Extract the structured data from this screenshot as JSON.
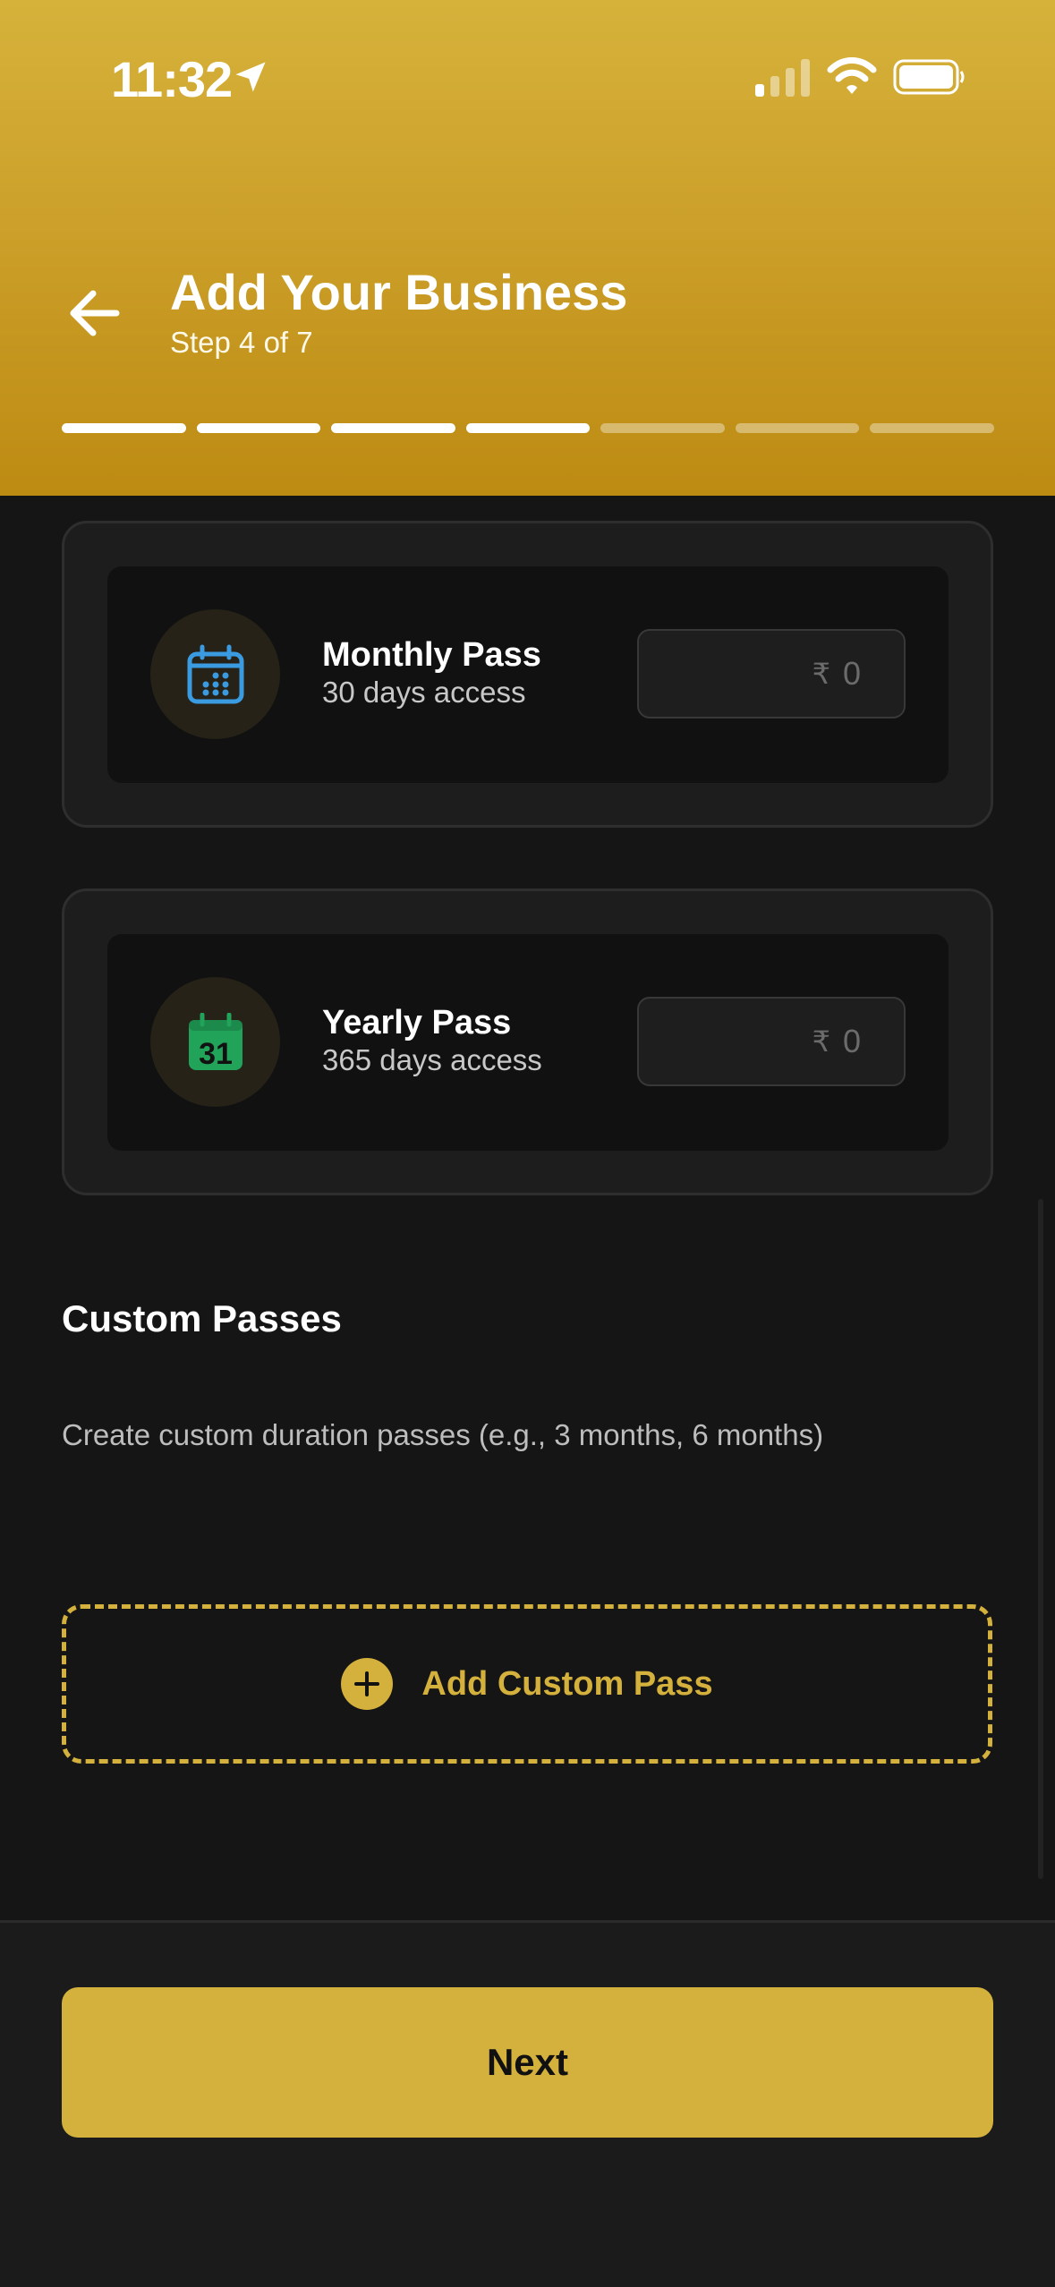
{
  "status_bar": {
    "time": "11:32"
  },
  "header": {
    "title": "Add Your Business",
    "subtitle": "Step 4 of 7",
    "progress": {
      "current_step": 4,
      "total_steps": 7
    }
  },
  "passes": [
    {
      "name": "Monthly Pass",
      "description": "30 days access",
      "currency": "₹",
      "placeholder": "0",
      "icon": "calendar-icon",
      "icon_color": "#3b9be0"
    },
    {
      "name": "Yearly Pass",
      "description": "365 days access",
      "currency": "₹",
      "placeholder": "0",
      "icon": "calendar-31-icon",
      "icon_color": "#22a35a",
      "icon_text": "31"
    }
  ],
  "custom": {
    "title": "Custom Passes",
    "description": "Create custom duration passes (e.g., 3 months, 6 months)",
    "add_label": "Add Custom Pass"
  },
  "footer": {
    "next_label": "Next"
  },
  "colors": {
    "accent": "#d4b03c",
    "background": "#151515",
    "header_top": "#d6b23b",
    "header_bottom": "#bd8b12"
  }
}
